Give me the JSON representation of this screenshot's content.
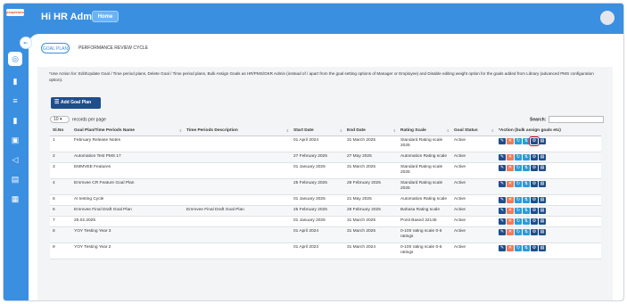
{
  "app": {
    "logo_text": "peoplestrong",
    "greeting": "Hi HR Admin",
    "home_label": "Home"
  },
  "tabs": [
    {
      "label": "GOAL PLAN",
      "active": true
    },
    {
      "label": "PERFORMANCE REVIEW CYCLE",
      "active": false
    }
  ],
  "note": "*Use Action for: Edit/Update Goal / Time period plans, Delete Goal / Time period plans, Bulk Assign Goals as HR/PMS/OKR Admin (instead of / apart from the goal setting options of Manager or Employee) and Disable editing weight option for the goals added from Library (advanced PMS configuration option).",
  "add_button": "Add Goal Plan",
  "length": {
    "value": "10",
    "label": "records per page"
  },
  "search_label": "Search:",
  "columns": [
    "Sl.No",
    "Goal Plan/Time Periods Name",
    "Time Periods Description",
    "Start Date",
    "End Date",
    "Rating Scale",
    "Goal Status",
    "*Action (bulk assign goals etc)"
  ],
  "rows": [
    {
      "sl": "1",
      "name": "February Release Notes",
      "desc": "",
      "start": "01 April 2024",
      "end": "31 March 2025",
      "scale": "Standard Rating scale 2025",
      "status": "Active"
    },
    {
      "sl": "2",
      "name": "Automation Test PMS 17",
      "desc": "",
      "start": "27 February 2025",
      "end": "27 May 2025",
      "scale": "Automation Rating scale",
      "status": "Active"
    },
    {
      "sl": "3",
      "name": "EMMVEE Features",
      "desc": "",
      "start": "01 January 2025",
      "end": "31 March 2025",
      "scale": "Standard Rating scale 2025",
      "status": "Active"
    },
    {
      "sl": "4",
      "name": "Emmvee CR Feature Goal Plan",
      "desc": "",
      "start": "25 February 2025",
      "end": "28 February 2025",
      "scale": "Standard Rating scale 2025",
      "status": "Active"
    },
    {
      "sl": "5",
      "name": "AI testing Cycle",
      "desc": "",
      "start": "01 January 2025",
      "end": "21 May 2025",
      "scale": "Automation Rating scale",
      "status": "Active"
    },
    {
      "sl": "6",
      "name": "Emmvee Final Draft Goal Plan",
      "desc": "Emmvee Final Draft Goal Plan",
      "start": "25 February 2025",
      "end": "28 February 2025",
      "scale": "Bahasa Rating scale",
      "status": "Active"
    },
    {
      "sl": "7",
      "name": "25.02.2025",
      "desc": "",
      "start": "01 January 2025",
      "end": "31 March 2025",
      "scale": "Ponit Based 32145",
      "status": "Active"
    },
    {
      "sl": "8",
      "name": "YOY Testing Year 3",
      "desc": "",
      "start": "01 April 2024",
      "end": "31 March 2025",
      "scale": "0-100 rating scale 0-5 ratings",
      "status": "Active"
    },
    {
      "sl": "9",
      "name": "YOY Testing Year 2",
      "desc": "",
      "start": "01 April 2023",
      "end": "31 March 2024",
      "scale": "0-100 rating scale 0-5 ratings",
      "status": "Active"
    }
  ],
  "action_icons": [
    "edit-icon",
    "delete-icon",
    "assign-icon",
    "bulk-assign-icon",
    "settings-icon",
    "document-icon"
  ],
  "highlighted_action": {
    "row": "1",
    "icon": "settings-icon"
  },
  "colors": {
    "brand_blue": "#3a8fe0",
    "dark_blue": "#1f4e8c",
    "delete_orange": "#f07a5a",
    "assign_blue": "#2f9bd6",
    "highlight_red": "#d0021b"
  }
}
